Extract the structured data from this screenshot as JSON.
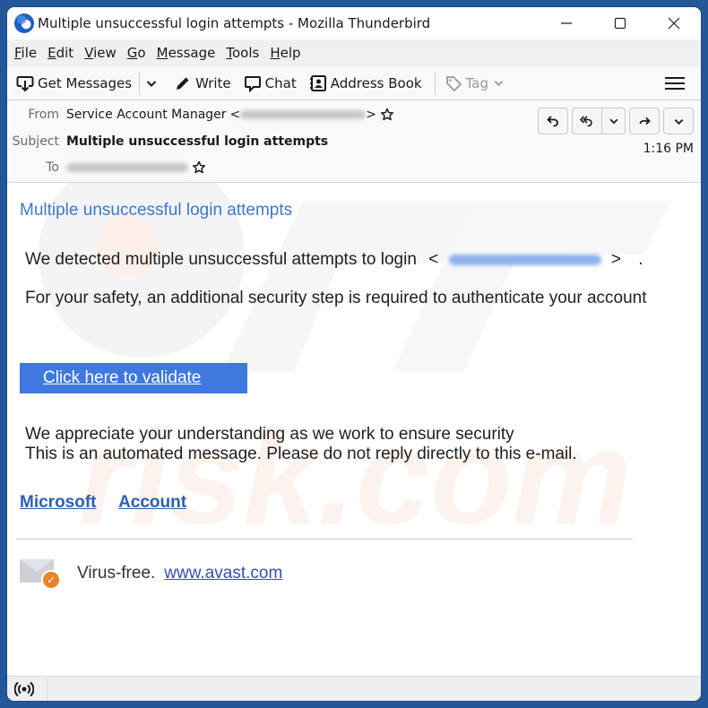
{
  "window": {
    "title": "Multiple unsuccessful login attempts - Mozilla Thunderbird",
    "controls": {
      "minimize": "minimize",
      "maximize": "maximize",
      "close": "close"
    }
  },
  "menu": [
    {
      "label": "File",
      "accel": "F",
      "rest": "ile"
    },
    {
      "label": "Edit",
      "accel": "E",
      "rest": "dit"
    },
    {
      "label": "View",
      "accel": "V",
      "rest": "iew"
    },
    {
      "label": "Go",
      "accel": "G",
      "rest": "o"
    },
    {
      "label": "Message",
      "accel": "M",
      "rest": "essage"
    },
    {
      "label": "Tools",
      "accel": "T",
      "rest": "ools"
    },
    {
      "label": "Help",
      "accel": "H",
      "rest": "elp"
    }
  ],
  "toolbar": {
    "get_messages": "Get Messages",
    "write": "Write",
    "chat": "Chat",
    "address_book": "Address Book",
    "tag": "Tag"
  },
  "header": {
    "from_label": "From",
    "from_name": "Service Account Manager",
    "from_open": "<",
    "from_close": ">",
    "subject_label": "Subject",
    "subject": "Multiple unsuccessful login attempts",
    "to_label": "To",
    "time": "1:16 PM"
  },
  "body": {
    "title": "Multiple unsuccessful login attempts",
    "line1_prefix": "We detected multiple unsuccessful attempts to login",
    "line1_open": "<",
    "line1_close": ">",
    "line1_end": ".",
    "line2": "For your safety, an additional security step is required to authenticate your account",
    "cta_label": "Click here to validate",
    "line3": "We appreciate your understanding as we work to ensure security",
    "line4": "This is an automated message. Please do not reply directly to this e-mail.",
    "footer_links": [
      "Microsoft",
      "Account"
    ],
    "virus_free_text": "Virus-free.",
    "avast_link": "www.avast.com"
  },
  "colors": {
    "desktop": "#24579a",
    "cta_bg": "#3f78de",
    "body_title": "#3e78c9",
    "link": "#2f5fb0",
    "avast_badge": "#e8852a"
  }
}
